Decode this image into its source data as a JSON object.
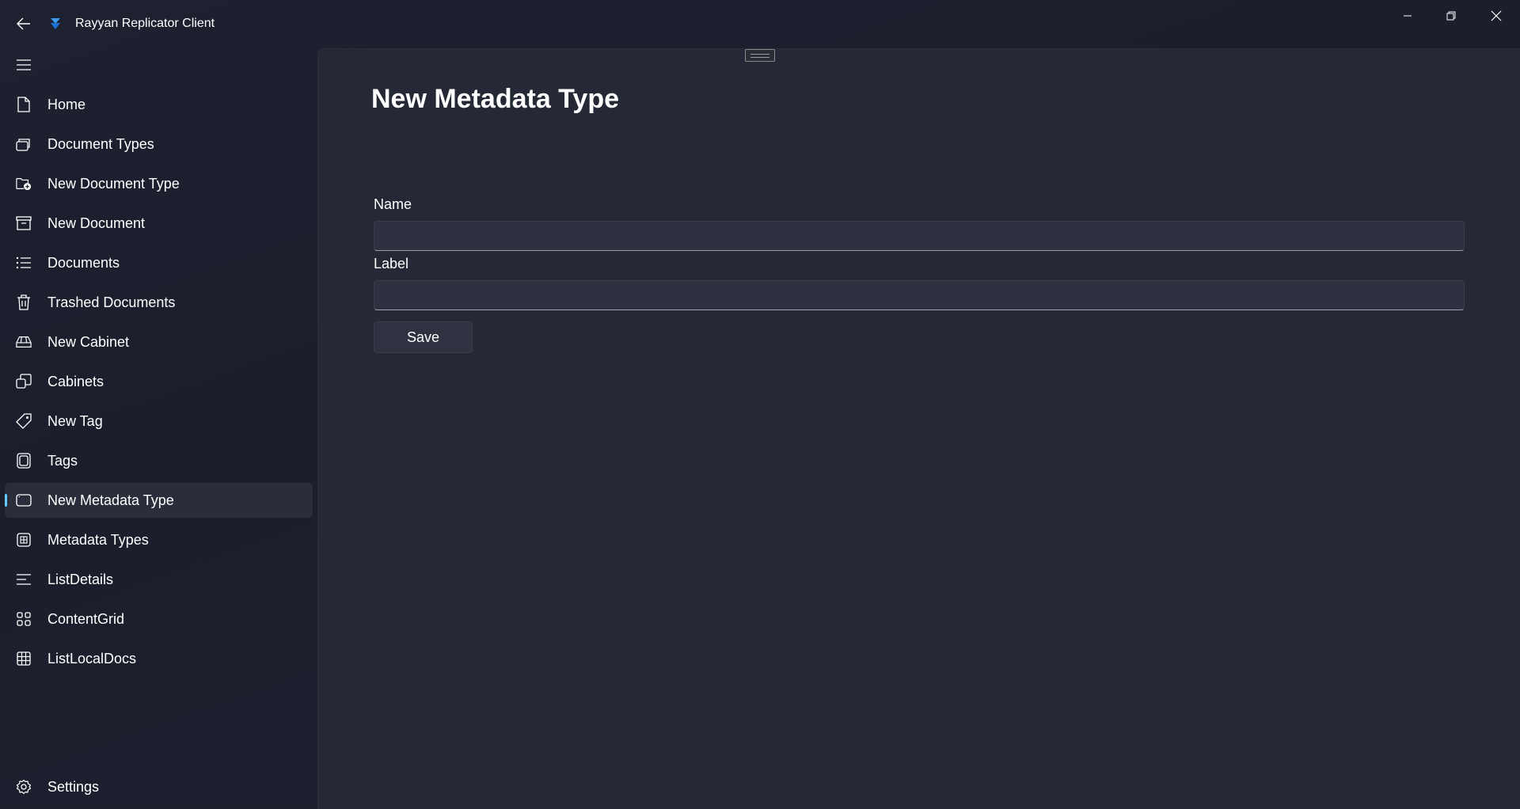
{
  "window": {
    "title": "Rayyan Replicator Client"
  },
  "nav": {
    "items": [
      {
        "label": "Home",
        "icon": "document-icon"
      },
      {
        "label": "Document Types",
        "icon": "document-stack-icon"
      },
      {
        "label": "New Document Type",
        "icon": "folder-add-icon"
      },
      {
        "label": "New Document",
        "icon": "archive-icon"
      },
      {
        "label": "Documents",
        "icon": "list-icon"
      },
      {
        "label": "Trashed Documents",
        "icon": "trash-icon"
      },
      {
        "label": "New Cabinet",
        "icon": "cabinet-icon"
      },
      {
        "label": "Cabinets",
        "icon": "copy-icon"
      },
      {
        "label": "New Tag",
        "icon": "tag-icon"
      },
      {
        "label": "Tags",
        "icon": "tags-icon"
      },
      {
        "label": "New Metadata Type",
        "icon": "rectangle-icon",
        "selected": true
      },
      {
        "label": "Metadata Types",
        "icon": "grid-box-icon"
      },
      {
        "label": "ListDetails",
        "icon": "list-details-icon"
      },
      {
        "label": "ContentGrid",
        "icon": "content-grid-icon"
      },
      {
        "label": "ListLocalDocs",
        "icon": "table-icon"
      }
    ],
    "settings_label": "Settings",
    "accent": "#60cdff"
  },
  "page": {
    "title": "New Metadata Type",
    "name_label": "Name",
    "name_value": "",
    "label_label": "Label",
    "label_value": "",
    "save_label": "Save"
  }
}
